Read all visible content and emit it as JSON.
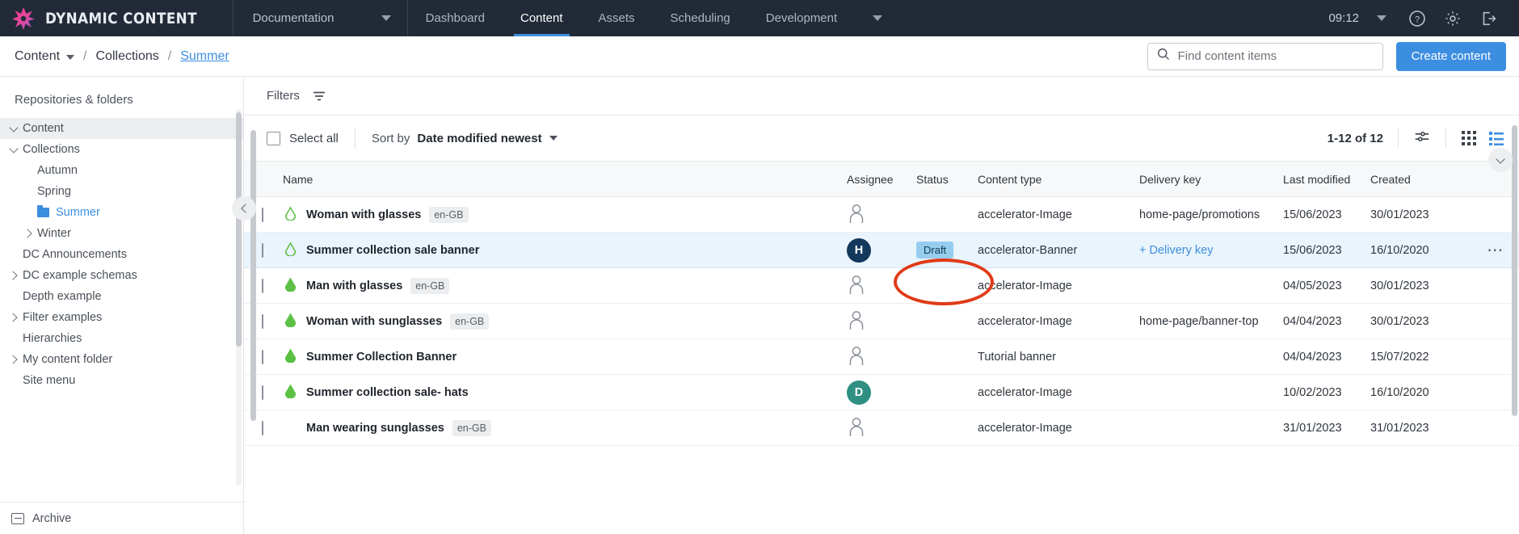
{
  "topnav": {
    "brand": "DYNAMIC CONTENT",
    "logo_icon": "star-burst-logo-icon",
    "docs_menu": {
      "label": "Documentation",
      "caret_icon": "chevron-down-icon"
    },
    "items": [
      {
        "label": "Dashboard",
        "active": false
      },
      {
        "label": "Content",
        "active": true
      },
      {
        "label": "Assets",
        "active": false
      },
      {
        "label": "Scheduling",
        "active": false
      },
      {
        "label": "Development",
        "active": false
      }
    ],
    "more_icon": "chevron-down-icon",
    "clock": "09:12",
    "clock_caret_icon": "chevron-down-icon",
    "help_icon": "help-circle-icon",
    "settings_icon": "gear-icon",
    "logout_icon": "logout-icon",
    "bg_color": "#222a38",
    "accent_color": "#3c8ee0"
  },
  "breadcrumb": {
    "items": [
      {
        "label": "Content",
        "link": false,
        "has_caret": true
      },
      {
        "label": "Collections",
        "link": false,
        "has_caret": false
      },
      {
        "label": "Summer",
        "link": true,
        "has_caret": false
      }
    ],
    "separator": "/"
  },
  "search": {
    "placeholder": "Find content items",
    "value": "",
    "icon": "search-icon"
  },
  "create_button": {
    "label": "Create content"
  },
  "sidebar": {
    "title": "Repositories & folders",
    "tree": [
      {
        "label": "Content",
        "indent": 0,
        "toggle": "down",
        "icon": "none",
        "selected": true,
        "active": false
      },
      {
        "label": "Collections",
        "indent": 0,
        "toggle": "down",
        "icon": "none",
        "selected": false,
        "active": false
      },
      {
        "label": "Autumn",
        "indent": 1,
        "toggle": "none",
        "icon": "none",
        "selected": false,
        "active": false
      },
      {
        "label": "Spring",
        "indent": 1,
        "toggle": "none",
        "icon": "none",
        "selected": false,
        "active": false
      },
      {
        "label": "Summer",
        "indent": 1,
        "toggle": "none",
        "icon": "folder",
        "selected": false,
        "active": true
      },
      {
        "label": "Winter",
        "indent": 1,
        "toggle": "right",
        "icon": "none",
        "selected": false,
        "active": false
      },
      {
        "label": "DC Announcements",
        "indent": 0,
        "toggle": "none",
        "icon": "none",
        "selected": false,
        "active": false
      },
      {
        "label": "DC example schemas",
        "indent": 0,
        "toggle": "right",
        "icon": "none",
        "selected": false,
        "active": false
      },
      {
        "label": "Depth example",
        "indent": 0,
        "toggle": "none",
        "icon": "none",
        "selected": false,
        "active": false
      },
      {
        "label": "Filter examples",
        "indent": 0,
        "toggle": "right",
        "icon": "none",
        "selected": false,
        "active": false
      },
      {
        "label": "Hierarchies",
        "indent": 0,
        "toggle": "none",
        "icon": "none",
        "selected": false,
        "active": false
      },
      {
        "label": "My content folder",
        "indent": 0,
        "toggle": "right",
        "icon": "none",
        "selected": false,
        "active": false
      },
      {
        "label": "Site menu",
        "indent": 0,
        "toggle": "none",
        "icon": "none",
        "selected": false,
        "active": false
      }
    ],
    "archive": {
      "label": "Archive",
      "icon": "archive-box-icon"
    },
    "collapse_icon": "chevron-left-icon"
  },
  "toolbar": {
    "filters_label": "Filters",
    "filters_icon": "filter-icon",
    "select_all_label": "Select all",
    "select_all_checked": false,
    "sort_by_label": "Sort by",
    "sort_value": "Date modified newest",
    "sort_caret_icon": "chevron-down-icon",
    "pagination": "1-12 of 12",
    "settings_icon": "sliders-icon",
    "grid_view_icon": "grid-view-icon",
    "list_view_icon": "list-view-icon",
    "active_view": "list",
    "collapse_down_icon": "chevron-down-icon"
  },
  "table": {
    "columns": [
      "Name",
      "Assignee",
      "Status",
      "Content type",
      "Delivery key",
      "Last modified",
      "Created"
    ],
    "rows": [
      {
        "name": "Woman with glasses",
        "locale": "en-GB",
        "cloud_icon": "cloud-outline-icon",
        "cloud_style": "outline",
        "assignee": null,
        "assignee_icon": "person-placeholder-icon",
        "status": "",
        "content_type": "accelerator-Image",
        "delivery_key": "home-page/promotions",
        "delivery_key_add": false,
        "last_modified": "15/06/2023",
        "created": "30/01/2023",
        "highlighted": false,
        "menu": false
      },
      {
        "name": "Summer collection sale banner",
        "locale": "",
        "cloud_icon": "cloud-outline-icon",
        "cloud_style": "outline",
        "assignee": "H",
        "assignee_color": "#12385c",
        "assignee_icon": "avatar-initial",
        "status": "Draft",
        "content_type": "accelerator-Banner",
        "delivery_key": "+ Delivery key",
        "delivery_key_add": true,
        "last_modified": "15/06/2023",
        "created": "16/10/2020",
        "highlighted": true,
        "menu": true,
        "menu_icon": "more-options-icon"
      },
      {
        "name": "Man with glasses",
        "locale": "en-GB",
        "cloud_icon": "cloud-filled-icon",
        "cloud_style": "filled",
        "assignee": null,
        "assignee_icon": "person-placeholder-icon",
        "status": "",
        "content_type": "accelerator-Image",
        "delivery_key": "",
        "delivery_key_add": false,
        "last_modified": "04/05/2023",
        "created": "30/01/2023",
        "highlighted": false,
        "menu": false
      },
      {
        "name": "Woman with sunglasses",
        "locale": "en-GB",
        "cloud_icon": "cloud-filled-icon",
        "cloud_style": "filled",
        "assignee": null,
        "assignee_icon": "person-placeholder-icon",
        "status": "",
        "content_type": "accelerator-Image",
        "delivery_key": "home-page/banner-top",
        "delivery_key_add": false,
        "last_modified": "04/04/2023",
        "created": "30/01/2023",
        "highlighted": false,
        "menu": false
      },
      {
        "name": "Summer Collection Banner",
        "locale": "",
        "cloud_icon": "cloud-filled-icon",
        "cloud_style": "filled",
        "assignee": null,
        "assignee_icon": "person-placeholder-icon",
        "status": "",
        "content_type": "Tutorial banner",
        "delivery_key": "",
        "delivery_key_add": false,
        "last_modified": "04/04/2023",
        "created": "15/07/2022",
        "highlighted": false,
        "menu": false
      },
      {
        "name": "Summer collection sale- hats",
        "locale": "",
        "cloud_icon": "cloud-filled-icon",
        "cloud_style": "filled",
        "assignee": "D",
        "assignee_color": "#2f8f82",
        "assignee_icon": "avatar-initial",
        "status": "",
        "content_type": "accelerator-Image",
        "delivery_key": "",
        "delivery_key_add": false,
        "last_modified": "10/02/2023",
        "created": "16/10/2020",
        "highlighted": false,
        "menu": false
      },
      {
        "name": "Man wearing sunglasses",
        "locale": "en-GB",
        "cloud_icon": "none",
        "cloud_style": "none",
        "assignee": null,
        "assignee_icon": "person-placeholder-icon",
        "status": "",
        "content_type": "accelerator-Image",
        "delivery_key": "",
        "delivery_key_add": false,
        "last_modified": "31/01/2023",
        "created": "31/01/2023",
        "highlighted": false,
        "menu": false
      }
    ]
  },
  "annotation": {
    "shape": "ellipse",
    "color": "#e03a18",
    "target": "delivery-key-add-link"
  }
}
